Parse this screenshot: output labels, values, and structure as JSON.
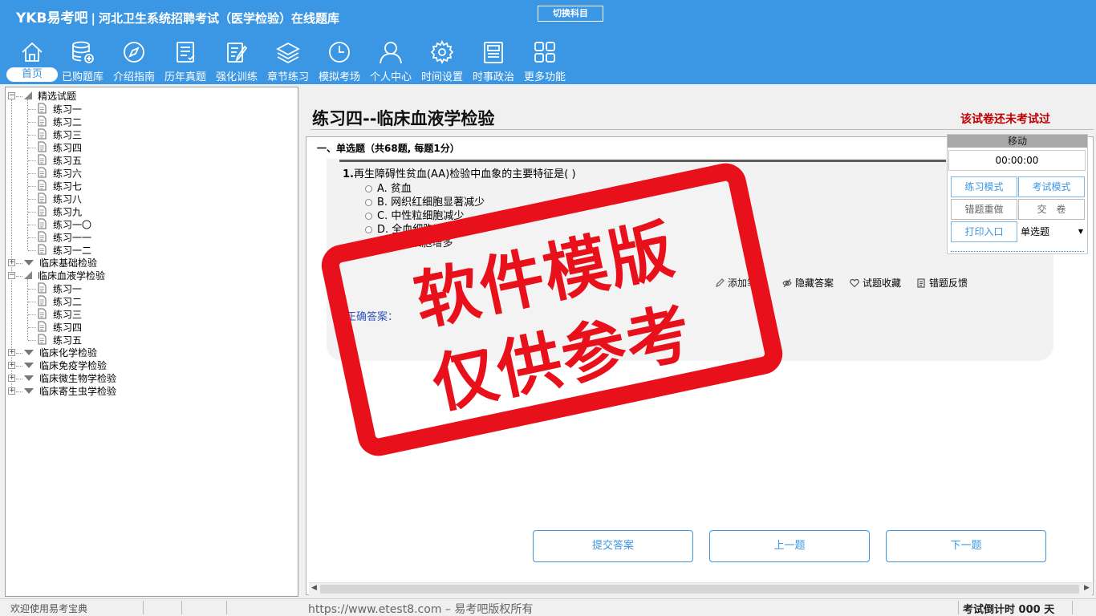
{
  "header": {
    "brand": "YKB易考吧",
    "title": "河北卫生系统招聘考试（医学检验）在线题库",
    "switch_label": "切换科目",
    "nav": [
      {
        "label": "首页",
        "icon": "home-icon",
        "active": true
      },
      {
        "label": "已购题库",
        "icon": "database-add-icon"
      },
      {
        "label": "介绍指南",
        "icon": "compass-icon"
      },
      {
        "label": "历年真题",
        "icon": "checklist-icon"
      },
      {
        "label": "强化训练",
        "icon": "edit-note-icon"
      },
      {
        "label": "章节练习",
        "icon": "layers-icon"
      },
      {
        "label": "模拟考场",
        "icon": "clock-icon"
      },
      {
        "label": "个人中心",
        "icon": "user-icon"
      },
      {
        "label": "时间设置",
        "icon": "gear-icon"
      },
      {
        "label": "时事政治",
        "icon": "newspaper-icon"
      },
      {
        "label": "更多功能",
        "icon": "grid-icon"
      }
    ]
  },
  "tree": {
    "groups": [
      {
        "label": "精选试题",
        "expanded": true,
        "items": [
          "练习一",
          "练习二",
          "练习三",
          "练习四",
          "练习五",
          "练习六",
          "练习七",
          "练习八",
          "练习九",
          "练习一〇",
          "练习一一",
          "练习一二"
        ]
      },
      {
        "label": "临床基础检验",
        "expanded": false,
        "items": []
      },
      {
        "label": "临床血液学检验",
        "expanded": true,
        "items": [
          "练习一",
          "练习二",
          "练习三",
          "练习四",
          "练习五"
        ]
      },
      {
        "label": "临床化学检验",
        "expanded": false,
        "items": []
      },
      {
        "label": "临床免疫学检验",
        "expanded": false,
        "items": []
      },
      {
        "label": "临床微生物学检验",
        "expanded": false,
        "items": []
      },
      {
        "label": "临床寄生虫学检验",
        "expanded": false,
        "items": []
      }
    ]
  },
  "paper": {
    "title": "练习四--临床血液学检验",
    "status": "该试卷还未考试过",
    "section": "一、单选题（共68题, 每题1分）"
  },
  "question": {
    "number": "1.",
    "text": "再生障碍性贫血(AA)检验中血象的主要特征是( )",
    "options": [
      "A. 贫血",
      "B. 网织红细胞显著减少",
      "C. 中性粒细胞减少",
      "D. 全血细胞减",
      "E. 淋巴细胞增多"
    ],
    "tools": [
      "添加笔记",
      "隐藏答案",
      "试题收藏",
      "错题反馈"
    ],
    "answer_label": "正确答案："
  },
  "buttons": {
    "submit": "提交答案",
    "prev": "上一题",
    "next": "下一题"
  },
  "float_panel": {
    "move": "移动",
    "timer": "00:00:00",
    "practice_mode": "练习模式",
    "exam_mode": "考试模式",
    "redo_wrong": "错题重做",
    "hand_in": "交　卷",
    "print": "打印入口",
    "type_select": "单选题"
  },
  "stamp": {
    "line1": "软件模版",
    "line2": "仅供参考"
  },
  "statusbar": {
    "welcome": "欢迎使用易考宝典",
    "copyright": "https://www.etest8.com – 易考吧版权所有",
    "countdown": "考试倒计时 000 天"
  },
  "colors": {
    "header_bg": "#3b96e3",
    "stamp": "#e8101a",
    "status_red": "#c00000",
    "accent_blue": "#3b96e3"
  }
}
